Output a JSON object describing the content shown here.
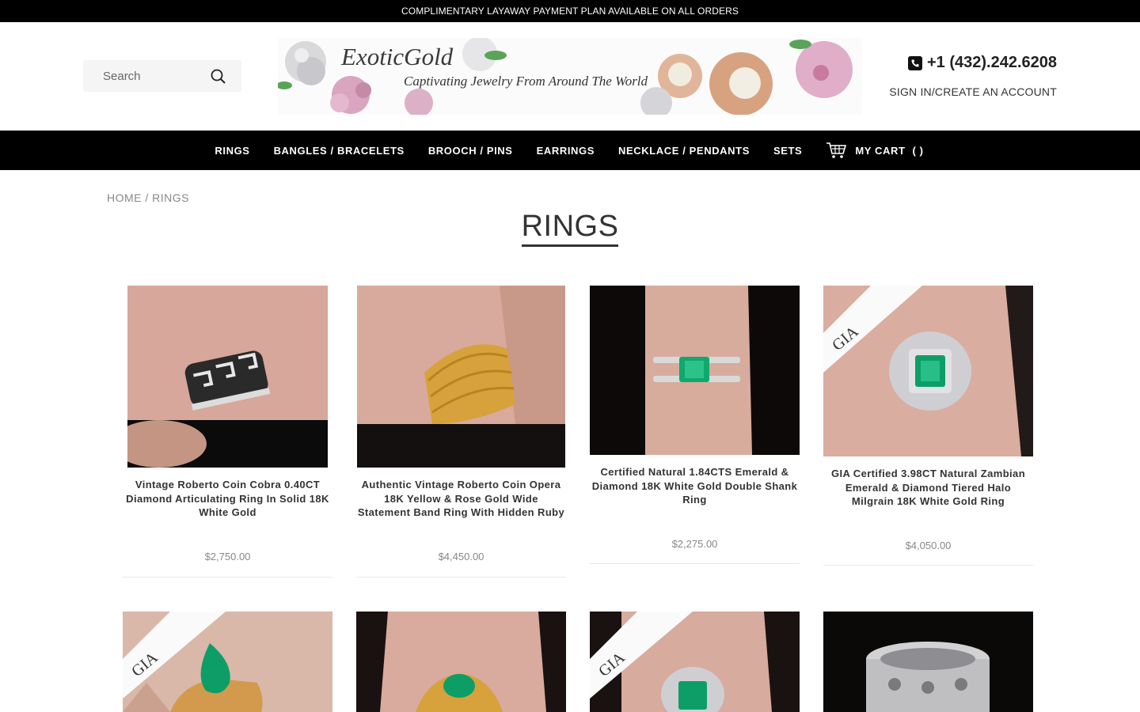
{
  "announcement": "COMPLIMENTARY LAYAWAY PAYMENT PLAN AVAILABLE ON ALL ORDERS",
  "search": {
    "placeholder": "Search"
  },
  "banner": {
    "brand": "ExoticGold",
    "tagline": "Captivating Jewelry From Around The World"
  },
  "contact": {
    "phone": "+1 (432).242.6208",
    "signin": "SIGN IN/CREATE AN ACCOUNT"
  },
  "nav": {
    "items": [
      "RINGS",
      "BANGLES / BRACELETS",
      "BROOCH / PINS",
      "EARRINGS",
      "NECKLACE / PENDANTS",
      "SETS"
    ],
    "cart_label": "MY CART",
    "cart_count": "( )"
  },
  "breadcrumb": "HOME / RINGS",
  "page_title": "RINGS",
  "colors": {
    "accent": "#000000",
    "price": "#888888",
    "text": "#333333"
  },
  "products": [
    {
      "name": "Vintage Roberto Coin Cobra 0.40CT Diamond Articulating Ring In Solid 18K White Gold",
      "price": "$2,750.00"
    },
    {
      "name": "Authentic Vintage Roberto Coin Opera 18K Yellow & Rose Gold Wide Statement Band Ring With Hidden Ruby",
      "price": "$4,450.00"
    },
    {
      "name": "Certified Natural 1.84CTS Emerald & Diamond 18K White Gold Double Shank Ring",
      "price": "$2,275.00"
    },
    {
      "name": "GIA Certified 3.98CT Natural Zambian Emerald & Diamond Tiered Halo Milgrain 18K White Gold Ring",
      "price": "$4,050.00"
    },
    {
      "name": "",
      "price": ""
    },
    {
      "name": "",
      "price": ""
    },
    {
      "name": "",
      "price": ""
    },
    {
      "name": "",
      "price": ""
    }
  ]
}
